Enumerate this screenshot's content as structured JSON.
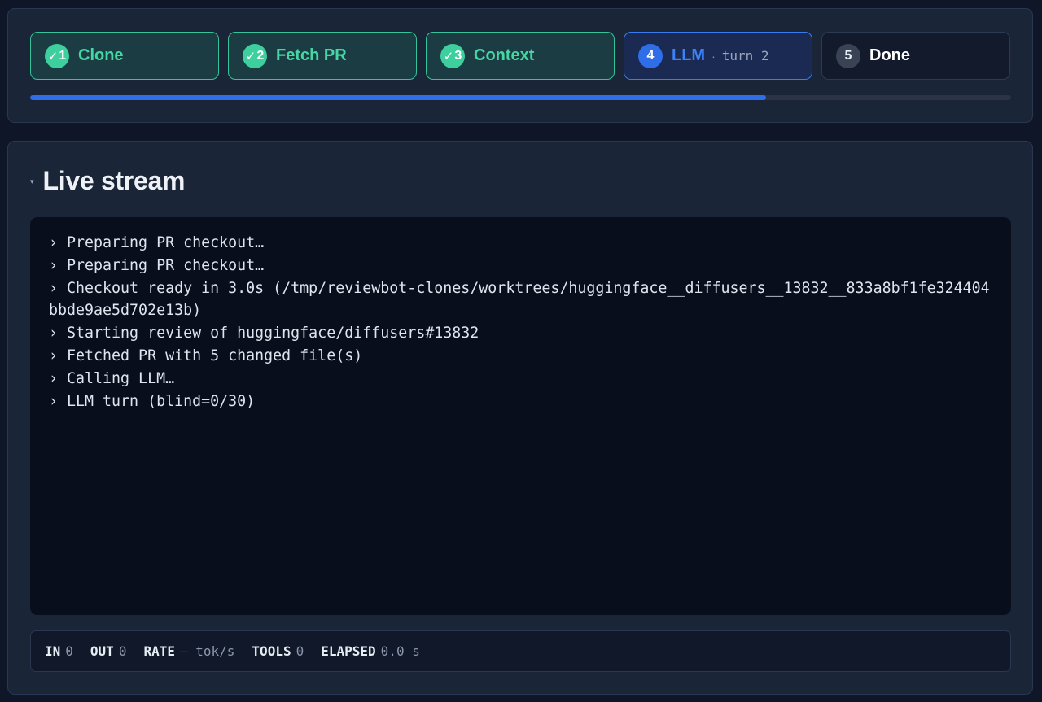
{
  "steps": [
    {
      "number": "1",
      "label": "Clone",
      "status": "done"
    },
    {
      "number": "2",
      "label": "Fetch PR",
      "status": "done"
    },
    {
      "number": "3",
      "label": "Context",
      "status": "done"
    },
    {
      "number": "4",
      "label": "LLM",
      "status": "active",
      "separator": "·",
      "detail": "turn 2"
    },
    {
      "number": "5",
      "label": "Done",
      "status": "pending"
    }
  ],
  "check_glyph": "✓",
  "progress": {
    "fraction": 0.75
  },
  "stream": {
    "title": "Live stream",
    "caret": "▾",
    "lines": [
      "› Preparing PR checkout…",
      "› Preparing PR checkout…",
      "› Checkout ready in 3.0s (/tmp/reviewbot-clones/worktrees/huggingface__diffusers__13832__833a8bf1fe324404bbde9ae5d702e13b)",
      "› Starting review of huggingface/diffusers#13832",
      "› Fetched PR with 5 changed file(s)",
      "› Calling LLM…",
      "› LLM turn (blind=0/30)"
    ]
  },
  "stats": {
    "in": {
      "label": "IN",
      "value": "0"
    },
    "out": {
      "label": "OUT",
      "value": "0"
    },
    "rate": {
      "label": "RATE",
      "value": "— tok/s"
    },
    "tools": {
      "label": "TOOLS",
      "value": "0"
    },
    "elapsed": {
      "label": "ELAPSED",
      "value": "0.0 s"
    }
  },
  "colors": {
    "background": "#0f1628",
    "panel": "#1b2538",
    "done_accent": "#3ecf9e",
    "active_accent": "#2f6ee8",
    "terminal_bg": "#090e1c"
  }
}
